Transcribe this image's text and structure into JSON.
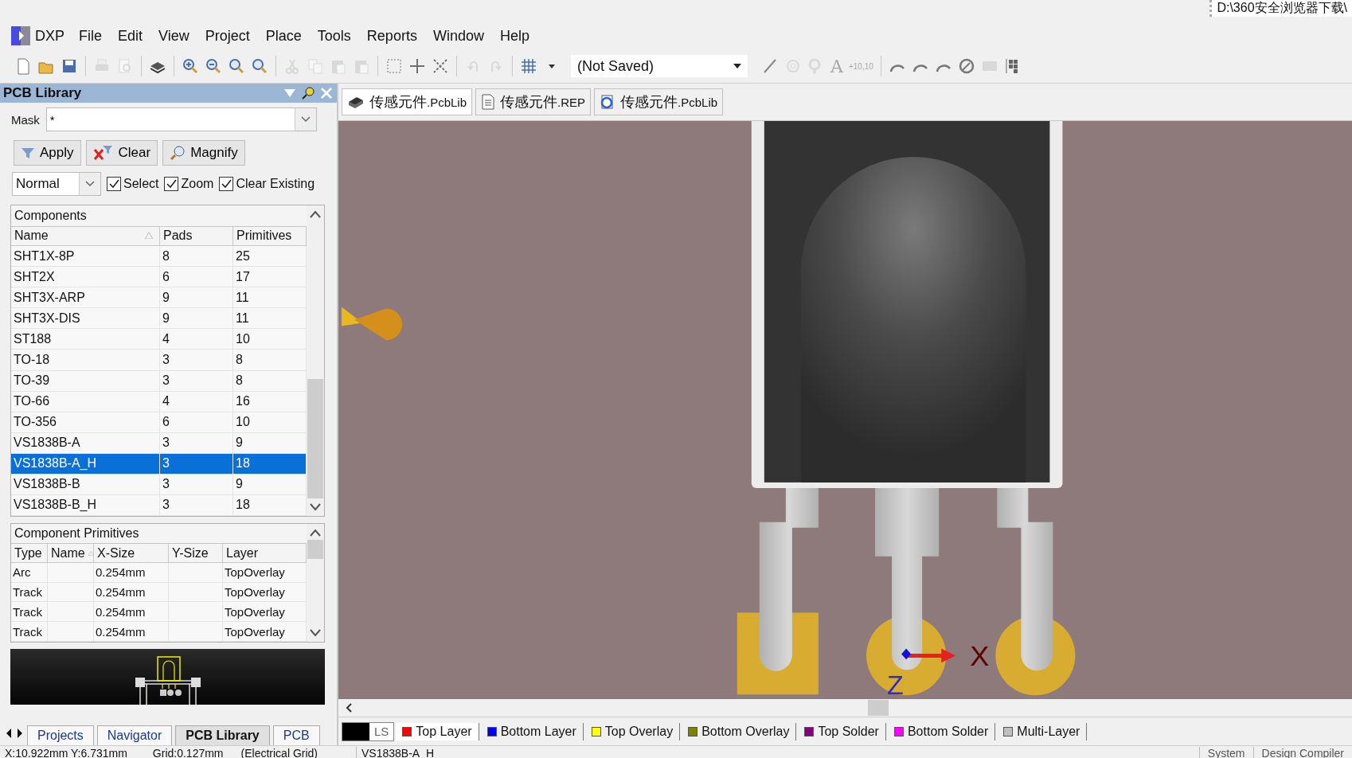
{
  "title_bar": {
    "path": "D:\\360安全浏览器下载\\"
  },
  "menu": {
    "app": "DXP",
    "items": [
      "File",
      "Edit",
      "View",
      "Project",
      "Place",
      "Tools",
      "Reports",
      "Window",
      "Help"
    ]
  },
  "toolbar": {
    "items": [
      {
        "kind": "new",
        "disabled": false
      },
      {
        "kind": "open",
        "disabled": false
      },
      {
        "kind": "save",
        "disabled": false
      },
      {
        "kind": "sep"
      },
      {
        "kind": "print",
        "disabled": true
      },
      {
        "kind": "preview",
        "disabled": true
      },
      {
        "kind": "sep"
      },
      {
        "kind": "layers",
        "disabled": false
      },
      {
        "kind": "sep"
      },
      {
        "kind": "zoomin",
        "disabled": false
      },
      {
        "kind": "zoomout",
        "disabled": false
      },
      {
        "kind": "zoomfit",
        "disabled": false
      },
      {
        "kind": "zoomarea",
        "disabled": false
      },
      {
        "kind": "sep"
      },
      {
        "kind": "cut",
        "disabled": true
      },
      {
        "kind": "copy",
        "disabled": true
      },
      {
        "kind": "paste",
        "disabled": true
      },
      {
        "kind": "pastespecial",
        "disabled": true
      },
      {
        "kind": "sep"
      },
      {
        "kind": "select",
        "disabled": false
      },
      {
        "kind": "move",
        "disabled": false
      },
      {
        "kind": "crossmove",
        "disabled": false
      },
      {
        "kind": "sep"
      },
      {
        "kind": "undo",
        "disabled": true
      },
      {
        "kind": "redo",
        "disabled": true
      },
      {
        "kind": "sep"
      },
      {
        "kind": "grid",
        "disabled": false
      },
      {
        "kind": "caret",
        "disabled": false
      }
    ],
    "combo": "(Not Saved)",
    "place_items": [
      {
        "kind": "line",
        "disabled": false
      },
      {
        "kind": "pad",
        "disabled": true
      },
      {
        "kind": "via",
        "disabled": true
      },
      {
        "kind": "text",
        "disabled": true,
        "label": "A"
      },
      {
        "kind": "coord",
        "disabled": true,
        "label": "+10,10"
      },
      {
        "kind": "sep"
      },
      {
        "kind": "arc",
        "disabled": false
      },
      {
        "kind": "arc",
        "disabled": false
      },
      {
        "kind": "arc",
        "disabled": false
      },
      {
        "kind": "circle",
        "disabled": false
      },
      {
        "kind": "fill",
        "disabled": true
      },
      {
        "kind": "array",
        "disabled": false
      }
    ]
  },
  "panel": {
    "title": "PCB Library",
    "mask": {
      "label": "Mask",
      "value": "*"
    },
    "buttons": [
      {
        "kind": "apply",
        "label": "Apply"
      },
      {
        "kind": "clear",
        "label": "Clear"
      },
      {
        "kind": "magnify",
        "label": "Magnify"
      }
    ],
    "mode": "Normal",
    "checkboxes": [
      {
        "label": "Select",
        "checked": true
      },
      {
        "label": "Zoom",
        "checked": true
      },
      {
        "label": "Clear Existing",
        "checked": true
      }
    ],
    "components": {
      "title": "Components",
      "columns": [
        "Name",
        "Pads",
        "Primitives"
      ],
      "rows": [
        {
          "name": "SHT1X-8P",
          "pads": "8",
          "primitives": "25",
          "selected": false
        },
        {
          "name": "SHT2X",
          "pads": "6",
          "primitives": "17",
          "selected": false
        },
        {
          "name": "SHT3X-ARP",
          "pads": "9",
          "primitives": "11",
          "selected": false
        },
        {
          "name": "SHT3X-DIS",
          "pads": "9",
          "primitives": "11",
          "selected": false
        },
        {
          "name": "ST188",
          "pads": "4",
          "primitives": "10",
          "selected": false
        },
        {
          "name": "TO-18",
          "pads": "3",
          "primitives": "8",
          "selected": false
        },
        {
          "name": "TO-39",
          "pads": "3",
          "primitives": "8",
          "selected": false
        },
        {
          "name": "TO-66",
          "pads": "4",
          "primitives": "16",
          "selected": false
        },
        {
          "name": "TO-356",
          "pads": "6",
          "primitives": "10",
          "selected": false
        },
        {
          "name": "VS1838B-A",
          "pads": "3",
          "primitives": "9",
          "selected": false
        },
        {
          "name": "VS1838B-A_H",
          "pads": "3",
          "primitives": "18",
          "selected": true
        },
        {
          "name": "VS1838B-B",
          "pads": "3",
          "primitives": "9",
          "selected": false
        },
        {
          "name": "VS1838B-B_H",
          "pads": "3",
          "primitives": "18",
          "selected": false
        }
      ]
    },
    "primitives": {
      "title": "Component Primitives",
      "columns": [
        "Type",
        "Name",
        "X-Size",
        "Y-Size",
        "Layer"
      ],
      "rows": [
        [
          "Arc",
          "",
          "0.254mm",
          "",
          "TopOverlay"
        ],
        [
          "Track",
          "",
          "0.254mm",
          "",
          "TopOverlay"
        ],
        [
          "Track",
          "",
          "0.254mm",
          "",
          "TopOverlay"
        ],
        [
          "Track",
          "",
          "0.254mm",
          "",
          "TopOverlay"
        ]
      ]
    },
    "tabs": [
      {
        "label": "Projects",
        "selected": false
      },
      {
        "label": "Navigator",
        "selected": false
      },
      {
        "label": "PCB Library",
        "selected": true
      },
      {
        "label": "PCB",
        "selected": false
      }
    ]
  },
  "doc_tabs": [
    {
      "name": "传感元件",
      "ext": ".PcbLib",
      "kind": "pcblib",
      "selected": true
    },
    {
      "name": "传感元件",
      "ext": ".REP",
      "kind": "report",
      "selected": false
    },
    {
      "name": "传感元件",
      "ext": ".PcbLib",
      "kind": "web",
      "selected": false
    }
  ],
  "canvas": {
    "axis_x": "X",
    "axis_z": "Z"
  },
  "layers": {
    "current": "LS",
    "tabs": [
      {
        "label": "Top Layer",
        "color": "#ff0000",
        "selected": true
      },
      {
        "label": "Bottom Layer",
        "color": "#0000ff",
        "selected": false
      },
      {
        "label": "Top Overlay",
        "color": "#ffff00",
        "selected": false
      },
      {
        "label": "Bottom Overlay",
        "color": "#808000",
        "selected": false
      },
      {
        "label": "Top Solder",
        "color": "#800080",
        "selected": false
      },
      {
        "label": "Bottom Solder",
        "color": "#ff00ff",
        "selected": false
      },
      {
        "label": "Multi-Layer",
        "color": "#c0c0c0",
        "selected": false
      }
    ]
  },
  "status_bar": {
    "position": "X:10.922mm Y:6.731mm",
    "grid": "Grid:0.127mm",
    "grid_mode": "(Electrical Grid)",
    "component": "VS1838B-A_H",
    "buttons": [
      "System",
      "Design Compiler"
    ]
  }
}
